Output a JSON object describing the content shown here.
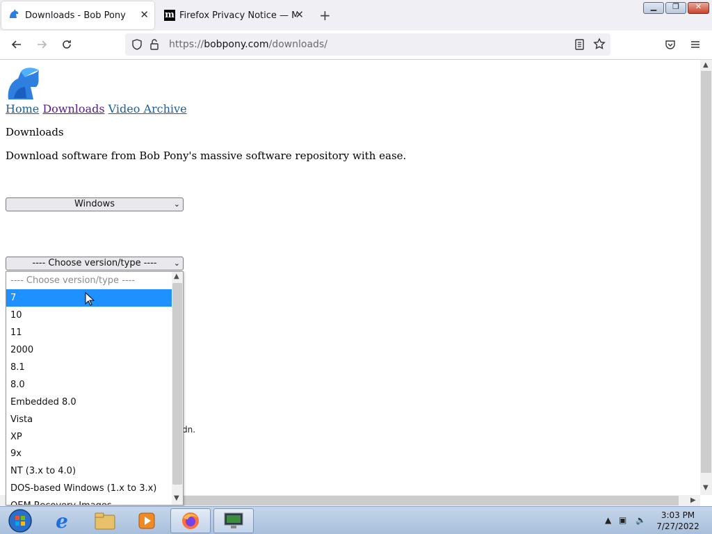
{
  "browser": {
    "tabs": [
      {
        "title": "Downloads - Bob Pony",
        "active": true,
        "icon": "bobpony-favicon"
      },
      {
        "title": "Firefox Privacy Notice — Mozilla",
        "active": false,
        "icon": "mozilla-m-icon"
      }
    ],
    "url": {
      "prefix": "https://",
      "host": "bobpony.com",
      "path": "/downloads/"
    }
  },
  "page": {
    "nav_links": [
      "Home",
      "Downloads",
      "Video Archive"
    ],
    "heading": "Downloads",
    "description": "Download software from Bob Pony's massive software repository with ease.",
    "os_select_value": "Windows",
    "version_select_value": "---- Choose version/type ----",
    "partial_text": "dn."
  },
  "dropdown": {
    "options": [
      "---- Choose version/type ----",
      "7",
      "10",
      "11",
      "2000",
      "8.1",
      "8.0",
      "Embedded 8.0",
      "Vista",
      "XP",
      "9x",
      "NT (3.x to 4.0)",
      "DOS-based Windows (1.x to 3.x)",
      "OEM Recovery Images"
    ],
    "highlighted": "7"
  },
  "taskbar": {
    "time": "3:03 PM",
    "date": "7/27/2022",
    "items": [
      "start-orb",
      "internet-explorer-icon",
      "file-explorer-icon",
      "media-player-icon",
      "firefox-icon",
      "remote-desktop-icon"
    ]
  },
  "colors": {
    "highlight": "#1e90ff",
    "link": "#1a5f9e",
    "visited_link": "#551a8b"
  }
}
